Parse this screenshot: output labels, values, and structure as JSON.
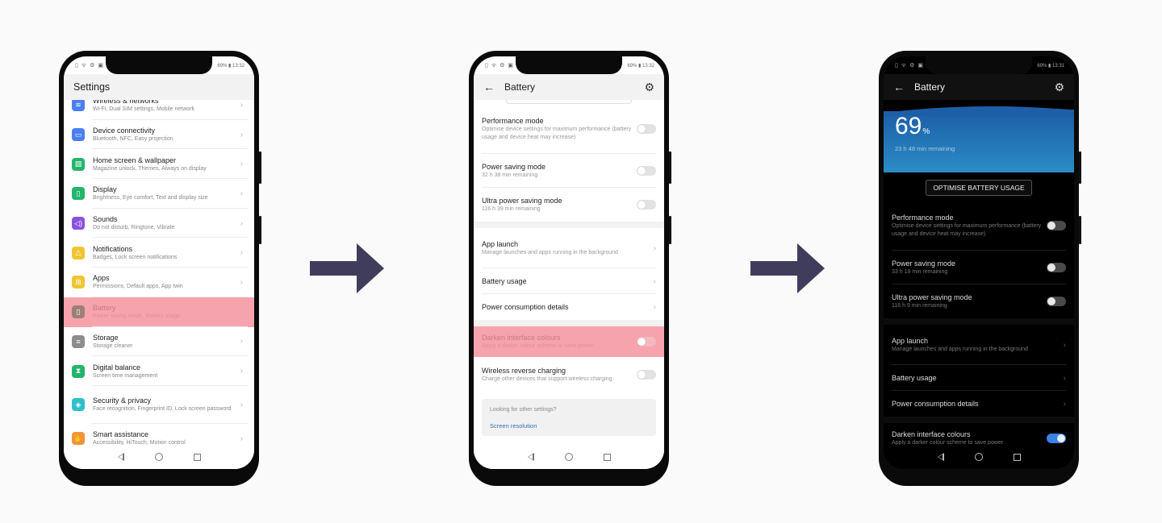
{
  "colors": {
    "arrow": "#403d5c",
    "highlight": "#f7a3ad",
    "toggle_on": "#3b82e6",
    "link": "#2f6fb7",
    "battery_gradient_top": "#1d5ea8",
    "battery_gradient_bottom": "#2b8cc4"
  },
  "phone1": {
    "status": {
      "left_icons": "▯ ᯤ ⚙ ▣ ⇵",
      "battery": "69%",
      "time": "13:32"
    },
    "title": "Settings",
    "items": [
      {
        "title": "Wireless & networks",
        "sub": "Wi-Fi, Dual SIM settings, Mobile network",
        "icon": "wifi-icon",
        "glyph": "≋",
        "color": "#4a7ff0"
      },
      {
        "title": "Device connectivity",
        "sub": "Bluetooth, NFC, Easy projection",
        "icon": "device-connectivity-icon",
        "glyph": "▭",
        "color": "#4a7ff0"
      },
      {
        "title": "Home screen & wallpaper",
        "sub": "Magazine unlock, Themes, Always on display",
        "icon": "wallpaper-icon",
        "glyph": "▨",
        "color": "#23b56b"
      },
      {
        "title": "Display",
        "sub": "Brightness, Eye comfort, Text and display size",
        "icon": "display-icon",
        "glyph": "▯",
        "color": "#23b56b"
      },
      {
        "title": "Sounds",
        "sub": "Do not disturb, Ringtone, Vibrate",
        "icon": "sound-icon",
        "glyph": "◁)",
        "color": "#8a52e0"
      },
      {
        "title": "Notifications",
        "sub": "Badges, Lock screen notifications",
        "icon": "bell-icon",
        "glyph": "△",
        "color": "#f0c531"
      },
      {
        "title": "Apps",
        "sub": "Permissions, Default apps, App twin",
        "icon": "apps-icon",
        "glyph": "⊞",
        "color": "#f0c531"
      },
      {
        "title": "Battery",
        "sub": "Power saving mode, Battery usage",
        "icon": "battery-icon",
        "glyph": "▯",
        "color": "#9e7f78",
        "highlighted": true
      },
      {
        "title": "Storage",
        "sub": "Storage cleaner",
        "icon": "storage-icon",
        "glyph": "≡",
        "color": "#8d8d8d"
      },
      {
        "title": "Digital balance",
        "sub": "Screen time management",
        "icon": "hourglass-icon",
        "glyph": "⧗",
        "color": "#23b56b"
      },
      {
        "title": "Security & privacy",
        "sub": "Face recognition, Fingerprint ID, Lock screen password",
        "icon": "shield-icon",
        "glyph": "◈",
        "color": "#2fbfc9",
        "tall": true
      },
      {
        "title": "Smart assistance",
        "sub": "Accessibility, HiTouch, Motion control",
        "icon": "hand-icon",
        "glyph": "✋",
        "color": "#f2953a"
      }
    ]
  },
  "phone2": {
    "status": {
      "left_icons": "▯ ᯤ ⚙ ▣ ⇵",
      "battery": "69%",
      "time": "13:32"
    },
    "title": "Battery",
    "toggles": [
      {
        "title": "Performance mode",
        "sub": "Optimise device settings for maximum performance (battery usage and device heat may increase)",
        "on": false
      },
      {
        "title": "Power saving mode",
        "sub": "32 h 38 min remaining",
        "on": false
      },
      {
        "title": "Ultra power saving mode",
        "sub": "116 h 39 min remaining",
        "on": false
      }
    ],
    "links": [
      {
        "title": "App launch",
        "sub": "Manage launches and apps running in the background"
      },
      {
        "title": "Battery usage",
        "sub": ""
      },
      {
        "title": "Power consumption details",
        "sub": ""
      }
    ],
    "darken": {
      "title": "Darken interface colours",
      "sub": "Apply a darker colour scheme to save power",
      "on": false,
      "highlighted": true
    },
    "wireless": {
      "title": "Wireless reverse charging",
      "sub": "Charge other devices that support wireless charging",
      "on": false
    },
    "tip": {
      "question": "Looking for other settings?",
      "link": "Screen resolution"
    }
  },
  "phone3": {
    "status": {
      "left_icons": "▯ ᯤ ⚙ ▣ ⇵",
      "battery": "69%",
      "time": "13:31"
    },
    "title": "Battery",
    "battery": {
      "percent": "69",
      "unit": "%",
      "remaining": "23 h 48 min remaining",
      "level": 0.69
    },
    "optimise_label": "OPTIMISE BATTERY USAGE",
    "toggles": [
      {
        "title": "Performance mode",
        "sub": "Optimise device settings for maximum performance (battery usage and device heat may increase)",
        "on": false
      },
      {
        "title": "Power saving mode",
        "sub": "33 h 18 min remaining",
        "on": false
      },
      {
        "title": "Ultra power saving mode",
        "sub": "116 h 9 min remaining",
        "on": false
      }
    ],
    "links": [
      {
        "title": "App launch",
        "sub": "Manage launches and apps running in the background"
      },
      {
        "title": "Battery usage",
        "sub": ""
      },
      {
        "title": "Power consumption details",
        "sub": ""
      }
    ],
    "darken": {
      "title": "Darken interface colours",
      "sub": "Apply a darker colour scheme to save power",
      "on": true
    }
  }
}
